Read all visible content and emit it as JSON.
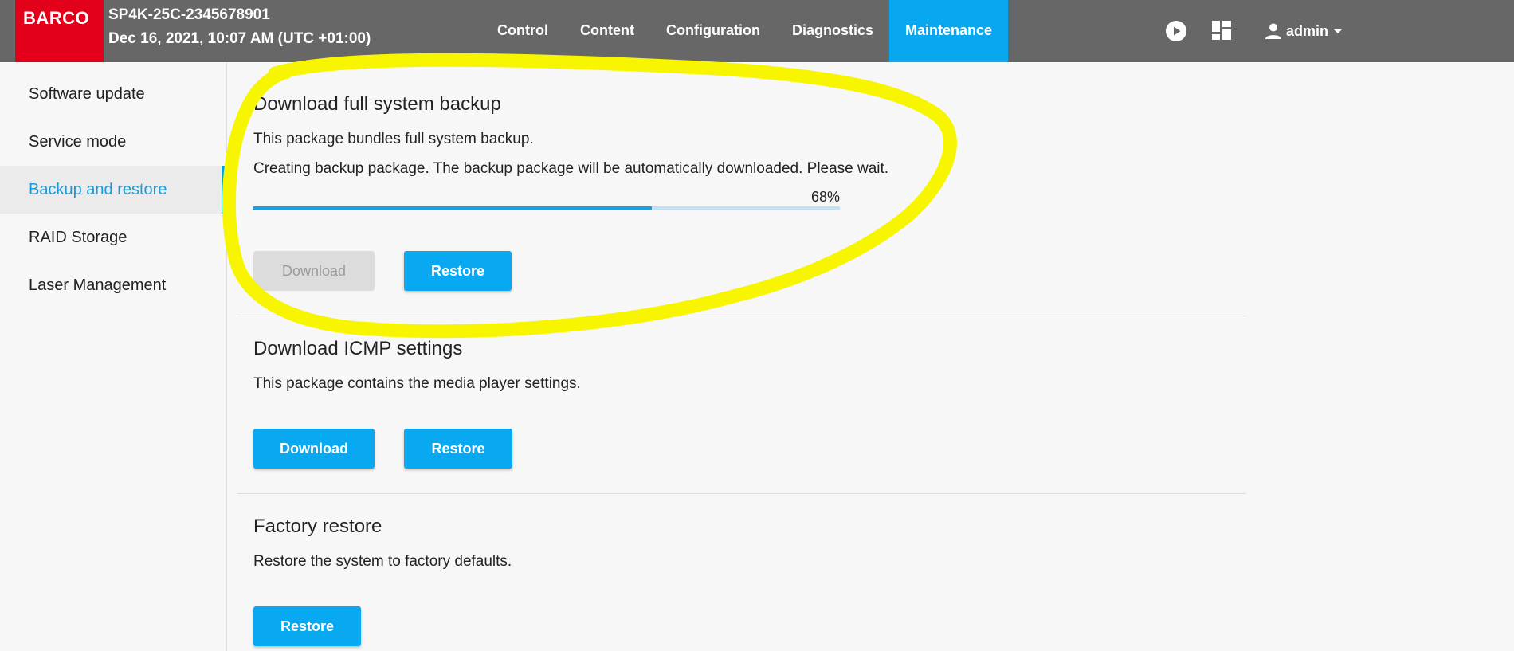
{
  "header": {
    "logo_text": "BARCO",
    "device_name": "SP4K-25C-2345678901",
    "datetime": "Dec 16, 2021, 10:07 AM (UTC +01:00)",
    "nav": [
      {
        "label": "Control",
        "active": false
      },
      {
        "label": "Content",
        "active": false
      },
      {
        "label": "Configuration",
        "active": false
      },
      {
        "label": "Diagnostics",
        "active": false
      },
      {
        "label": "Maintenance",
        "active": true
      }
    ],
    "icons": [
      "play-circle-icon",
      "dashboard-icon",
      "user-icon",
      "caret-down-icon"
    ],
    "user": "admin"
  },
  "sidebar": {
    "items": [
      {
        "label": "Software update",
        "active": false
      },
      {
        "label": "Service mode",
        "active": false
      },
      {
        "label": "Backup and restore",
        "active": true
      },
      {
        "label": "RAID Storage",
        "active": false
      },
      {
        "label": "Laser Management",
        "active": false
      }
    ]
  },
  "backup": {
    "title": "Download full system backup",
    "description": "This package bundles full system backup.",
    "status": "Creating backup package. The backup package will be automatically downloaded. Please wait.",
    "progress": 68,
    "progress_label": "68%",
    "download_label": "Download",
    "download_disabled": true,
    "restore_label": "Restore"
  },
  "icmp": {
    "title": "Download ICMP settings",
    "description": "This package contains the media player settings.",
    "download_label": "Download",
    "restore_label": "Restore"
  },
  "factory": {
    "title": "Factory restore",
    "description": "Restore the system to factory defaults.",
    "restore_label": "Restore"
  },
  "colors": {
    "topbar": "#676767",
    "brand_red": "#e3001b",
    "accent": "#08a8f0",
    "highlight_annotation": "#f7f600"
  }
}
